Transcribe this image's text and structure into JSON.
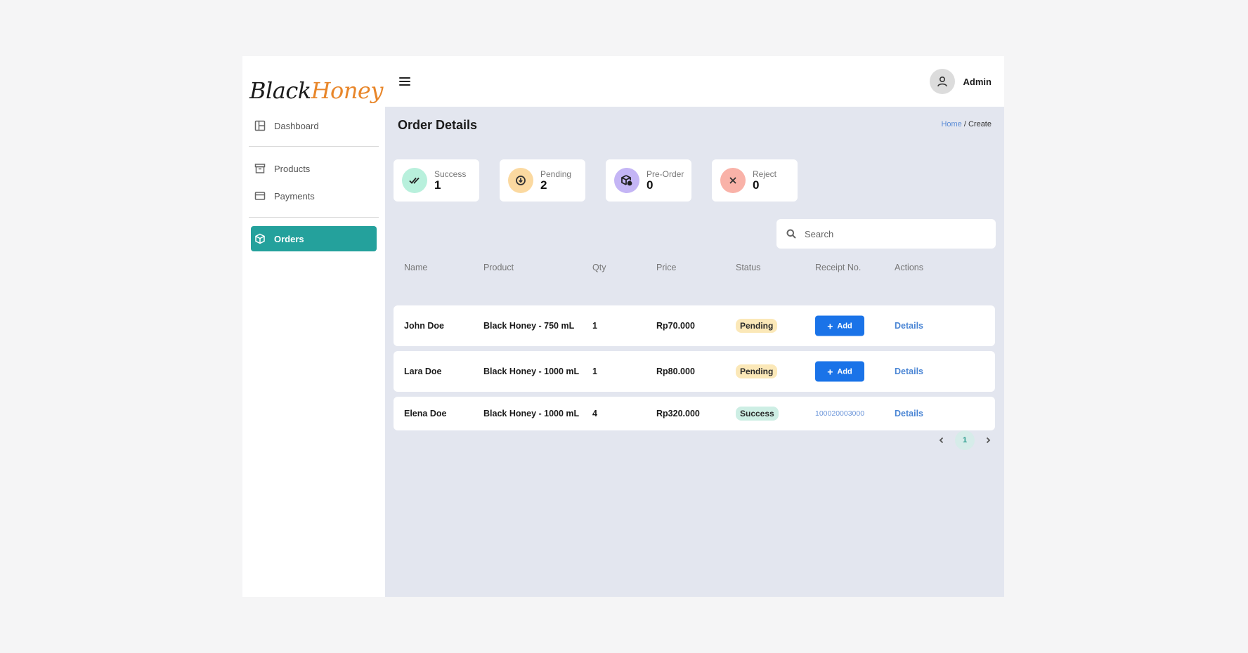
{
  "brand": {
    "part1": "Black",
    "part2": "Honey"
  },
  "sidebar": {
    "items": [
      {
        "label": "Dashboard",
        "icon": "layout-icon"
      },
      {
        "label": "Products",
        "icon": "archive-icon"
      },
      {
        "label": "Payments",
        "icon": "card-icon"
      },
      {
        "label": "Orders",
        "icon": "box-icon"
      }
    ],
    "active": "Orders"
  },
  "header": {
    "user_name": "Admin"
  },
  "page": {
    "title": "Order Details",
    "breadcrumb": {
      "home": "Home",
      "separator": " / ",
      "current": "Create"
    }
  },
  "stats": [
    {
      "label": "Success",
      "value": "1",
      "color": "#b8f0dc"
    },
    {
      "label": "Pending",
      "value": "2",
      "color": "#fbd9a0"
    },
    {
      "label": "Pre-Order",
      "value": "0",
      "color": "#c4b5f5"
    },
    {
      "label": "Reject",
      "value": "0",
      "color": "#f9b2a8"
    }
  ],
  "search": {
    "placeholder": "Search"
  },
  "table": {
    "columns": [
      "Name",
      "Product",
      "Qty",
      "Price",
      "Status",
      "Receipt No.",
      "Actions"
    ],
    "rows": [
      {
        "name": "John Doe",
        "product": "Black Honey - 750 mL",
        "qty": "1",
        "price": "Rp70.000",
        "status": "Pending",
        "receipt_action": "Add",
        "action": "Details"
      },
      {
        "name": "Lara Doe",
        "product": "Black Honey - 1000 mL",
        "qty": "1",
        "price": "Rp80.000",
        "status": "Pending",
        "receipt_action": "Add",
        "action": "Details"
      },
      {
        "name": "Elena Doe",
        "product": "Black Honey - 1000 mL",
        "qty": "4",
        "price": "Rp320.000",
        "status": "Success",
        "receipt": "100020003000",
        "action": "Details"
      }
    ]
  },
  "pagination": {
    "current": "1"
  },
  "colors": {
    "accent": "#24a19c",
    "primary_button": "#1a73e8",
    "content_bg": "#e3e6ef"
  }
}
